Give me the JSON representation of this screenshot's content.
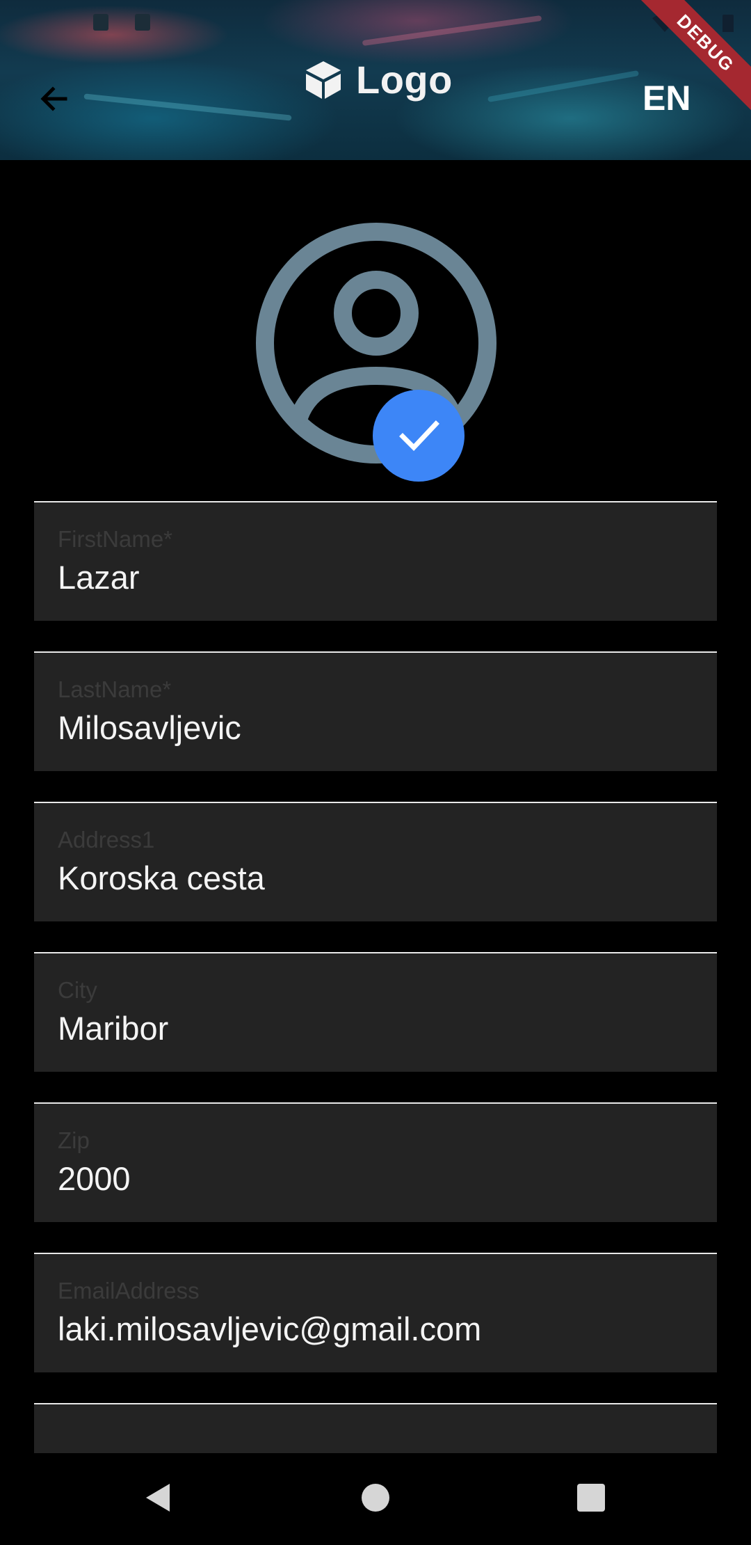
{
  "header": {
    "logo_text": "Logo",
    "language": "EN",
    "debug_label": "DEBUG"
  },
  "icons": {
    "back": "arrow-left-icon",
    "logo": "cube-icon",
    "avatar": "account-circle-icon",
    "check": "check-icon"
  },
  "form": {
    "fields": [
      {
        "label": "FirstName*",
        "value": "Lazar"
      },
      {
        "label": "LastName*",
        "value": "Milosavljevic"
      },
      {
        "label": "Address1",
        "value": "Koroska cesta"
      },
      {
        "label": "City",
        "value": "Maribor"
      },
      {
        "label": "Zip",
        "value": "2000"
      },
      {
        "label": "EmailAddress",
        "value": "laki.milosavljevic@gmail.com"
      }
    ]
  },
  "colors": {
    "accent": "#3d86f7",
    "avatar": "#6a8595",
    "field_bg": "#232323",
    "debug_banner": "#a52830"
  }
}
